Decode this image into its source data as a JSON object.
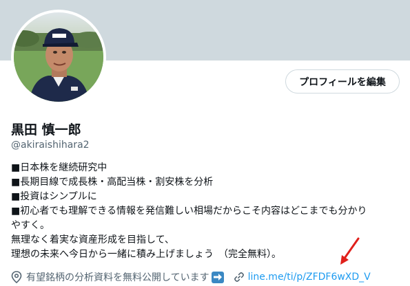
{
  "profile": {
    "edit_button": "プロフィールを編集",
    "name": "黒田 慎一郎",
    "handle": "@akiraishihara2",
    "bio": [
      "■日本株を継続研究中",
      "■長期目線で成長株・高配当株・割安株を分析",
      "■投資はシンプルに",
      "■初心者でも理解できる情報を発信難しい相場だからこそ内容はどこまでも分かり",
      "やすく。",
      "無理なく着実な資産形成を目指して、",
      "理想の未来へ今日から一緒に積み上げましょう　（完全無料）。"
    ],
    "location": "有望銘柄の分析資料を無料公開しています",
    "link": "line.me/ti/p/ZFDF6wXD_V"
  },
  "colors": {
    "banner": "#cfd9de",
    "link": "#1d9bf0",
    "secondary_text": "#536471",
    "annotation_arrow": "#e0201b"
  },
  "icons": [
    "location-pin-icon",
    "right-arrow-emoji-icon",
    "link-icon",
    "red-annotation-arrow"
  ]
}
